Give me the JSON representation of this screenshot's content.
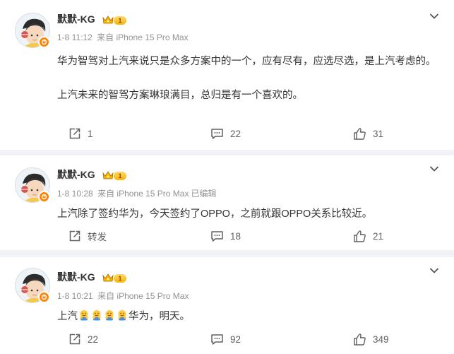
{
  "posts": [
    {
      "username": "默默-KG",
      "level": "1",
      "time": "1-8 11:12",
      "source": "来自 iPhone 15 Pro Max",
      "edited": "",
      "paragraphs": [
        "华为智驾对上汽来说只是众多方案中的一个，应有尽有，应选尽选，是上汽考虑的。",
        "上汽未来的智驾方案琳琅满目，总归是有一个喜欢的。"
      ],
      "reposts": "1",
      "comments": "22",
      "likes": "31"
    },
    {
      "username": "默默-KG",
      "level": "1",
      "time": "1-8 10:28",
      "source": "来自 iPhone 15 Pro Max",
      "edited": "已编辑",
      "paragraphs": [
        "上汽除了签约华为，今天签约了OPPO，之前就跟OPPO关系比较近。"
      ],
      "reposts": "转发",
      "comments": "18",
      "likes": "21"
    },
    {
      "username": "默默-KG",
      "level": "1",
      "time": "1-8 10:21",
      "source": "来自 iPhone 15 Pro Max",
      "edited": "",
      "text_start": "上汽",
      "emoji": "hug-emoji",
      "emoji_count": 4,
      "text_end": "华为，明天。",
      "reposts": "22",
      "comments": "92",
      "likes": "349"
    }
  ],
  "colors": {
    "page_bg": "#f1f2f5",
    "card_bg": "#ffffff",
    "text": "#333333",
    "meta": "#939393",
    "action": "#616161",
    "vip_badge": "#ff8200"
  }
}
